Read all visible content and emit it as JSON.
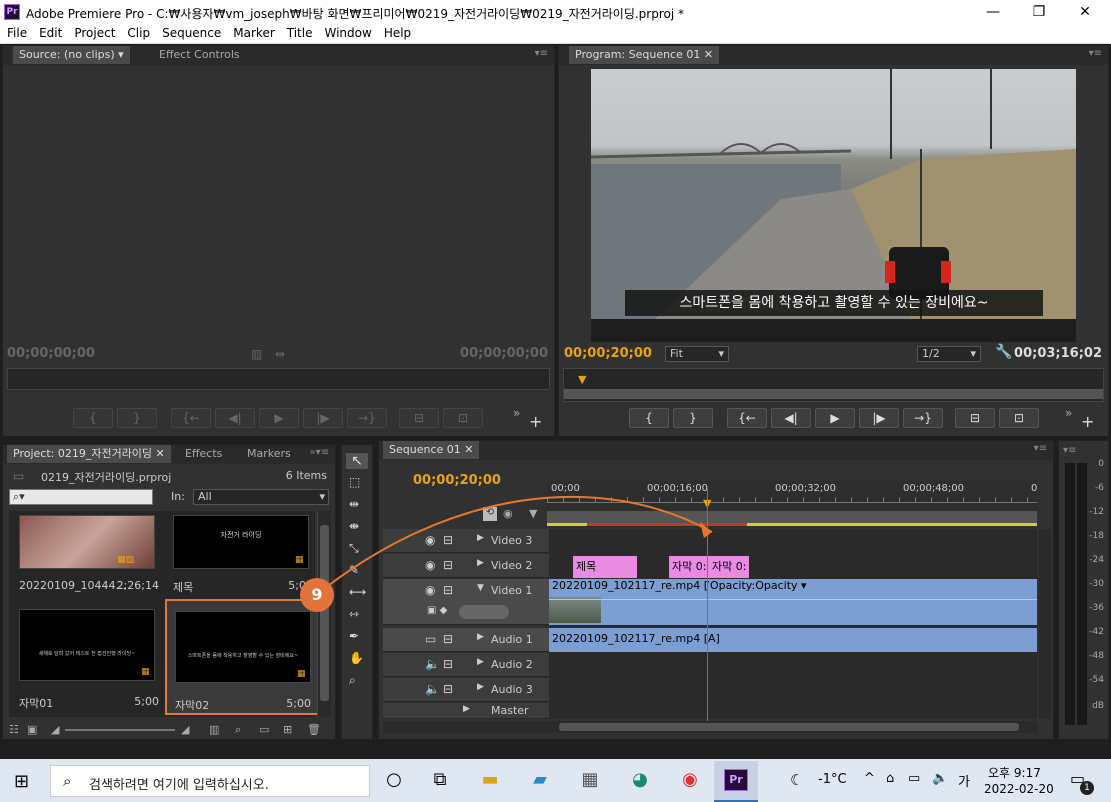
{
  "window": {
    "title": "Adobe Premiere Pro - C:₩사용자₩vm_joseph₩바탕 화면₩프리미어₩0219_자전거라이딩₩0219_자전거라이딩.prproj *",
    "app_badge": "Pr"
  },
  "menu": [
    "File",
    "Edit",
    "Project",
    "Clip",
    "Sequence",
    "Marker",
    "Title",
    "Window",
    "Help"
  ],
  "source": {
    "tab": "Source: (no clips)",
    "tab2": "Effect Controls",
    "tc_left": "00;00;00;00",
    "tc_right": "00;00;00;00"
  },
  "program": {
    "tab": "Program: Sequence 01",
    "subtitle": "스마트폰을 몸에 착용하고 촬영할 수 있는 장비에요~",
    "tc_current": "00;00;20;00",
    "fit": "Fit",
    "resolution": "1/2",
    "tc_duration": "00;03;16;02"
  },
  "transport": {
    "mark_in": "{",
    "mark_out": "}",
    "go_in": "{←",
    "step_back": "◀|",
    "play": "▶",
    "step_fwd": "|▶",
    "go_out": "→}",
    "lift": "⊟",
    "extract": "⊡",
    "more": "»",
    "add": "+"
  },
  "project": {
    "tab": "Project: 0219_자전거라이딩",
    "tab_effects": "Effects",
    "tab_markers": "Markers",
    "filename": "0219_자전거라이딩.prproj",
    "items_count": "6 Items",
    "in_label": "In:",
    "in_value": "All",
    "items": [
      {
        "name": "20220109_10444...",
        "duration": "2;26;14"
      },
      {
        "name": "제목",
        "duration": "5;00",
        "thumb_text": "자전거 라이딩"
      },
      {
        "name": "자막01",
        "duration": "5;00",
        "thumb_text": "새해로 달려 갔어 테스트 전 접선진행 라이딩~"
      },
      {
        "name": "자막02",
        "duration": "5;00",
        "thumb_text": "스마트폰을 몸에 착용하고 촬영할 수 있는 장비에요~"
      }
    ]
  },
  "callout": "9",
  "sequence": {
    "tab": "Sequence 01",
    "tc": "00;00;20;00",
    "ruler": [
      "00;00",
      "00;00;16;00",
      "00;00;32;00",
      "00;00;48;00",
      "0"
    ],
    "tracks": [
      {
        "name": "Video 3"
      },
      {
        "name": "Video 2"
      },
      {
        "name": "Video 1"
      },
      {
        "name": "Audio 1"
      },
      {
        "name": "Audio 2"
      },
      {
        "name": "Audio 3"
      },
      {
        "name": "Master"
      }
    ],
    "clips": {
      "title": "제목",
      "sub1": "자막 0:",
      "sub2": "자막 0:",
      "video": "20220109_102117_re.mp4 [V]",
      "opacity": "Opacity:Opacity ▾",
      "audio": "20220109_102117_re.mp4 [A]"
    }
  },
  "meter": {
    "labels": [
      "0",
      "-6",
      "-12",
      "-18",
      "-24",
      "-30",
      "-36",
      "-42",
      "-48",
      "-54",
      "dB"
    ]
  },
  "taskbar": {
    "search": "검색하려면 여기에 입력하십시오.",
    "weather": "-1°C",
    "ampm": "오후 9:17",
    "date": "2022-02-20",
    "ime": "가",
    "notify": "1"
  }
}
